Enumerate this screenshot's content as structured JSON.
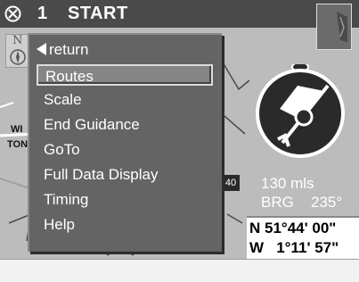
{
  "titlebar": {
    "page_number": "1",
    "title": "START"
  },
  "map": {
    "north_label": "N",
    "label_left_1": "WI",
    "label_left_2": "TON",
    "scale_box": "40"
  },
  "menu": {
    "items": [
      {
        "label": "return",
        "icon": "back-arrow-icon"
      },
      {
        "label": "Routes"
      },
      {
        "label": "Scale"
      },
      {
        "label": "End Guidance"
      },
      {
        "label": "GoTo"
      },
      {
        "label": "Full Data Display"
      },
      {
        "label": "Timing"
      },
      {
        "label": "Help"
      }
    ],
    "selected_index": 1
  },
  "navigation": {
    "distance": "130 mls",
    "bearing_label": "BRG",
    "bearing_value": "235°",
    "latitude": "N 51°44' 00\"",
    "longitude": "W   1°11' 57\""
  },
  "colors": {
    "titlebar_bg": "#4a4a4a",
    "menu_bg": "#646464",
    "selected_bg": "#858585",
    "map_bg": "#bcbcbc"
  }
}
